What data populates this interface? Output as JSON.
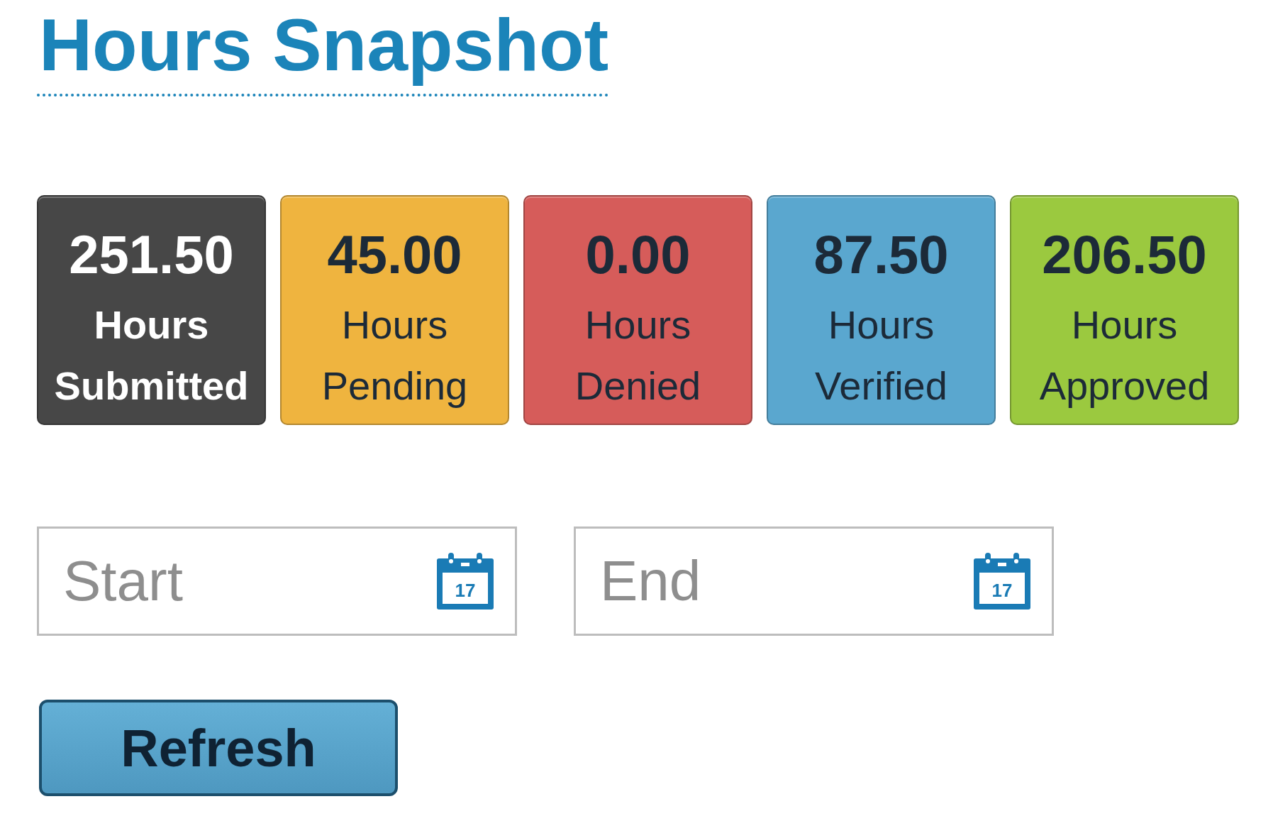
{
  "title": "Hours Snapshot",
  "tiles": [
    {
      "kind": "total",
      "value": "251.50",
      "label": "Hours Submitted",
      "color": "#474747"
    },
    {
      "kind": "status",
      "value": "45.00",
      "label": "Hours Pending",
      "color": "#efb43f"
    },
    {
      "kind": "status",
      "value": "0.00",
      "label": "Hours Denied",
      "color": "#d65c5a"
    },
    {
      "kind": "status",
      "value": "87.50",
      "label": "Hours Verified",
      "color": "#5aa7cf"
    },
    {
      "kind": "status",
      "value": "206.50",
      "label": "Hours Approved",
      "color": "#9bc93f"
    }
  ],
  "date_fields": [
    {
      "placeholder": "Start",
      "calendar_day": "17"
    },
    {
      "placeholder": "End",
      "calendar_day": "17"
    }
  ],
  "refresh_button": "Refresh"
}
